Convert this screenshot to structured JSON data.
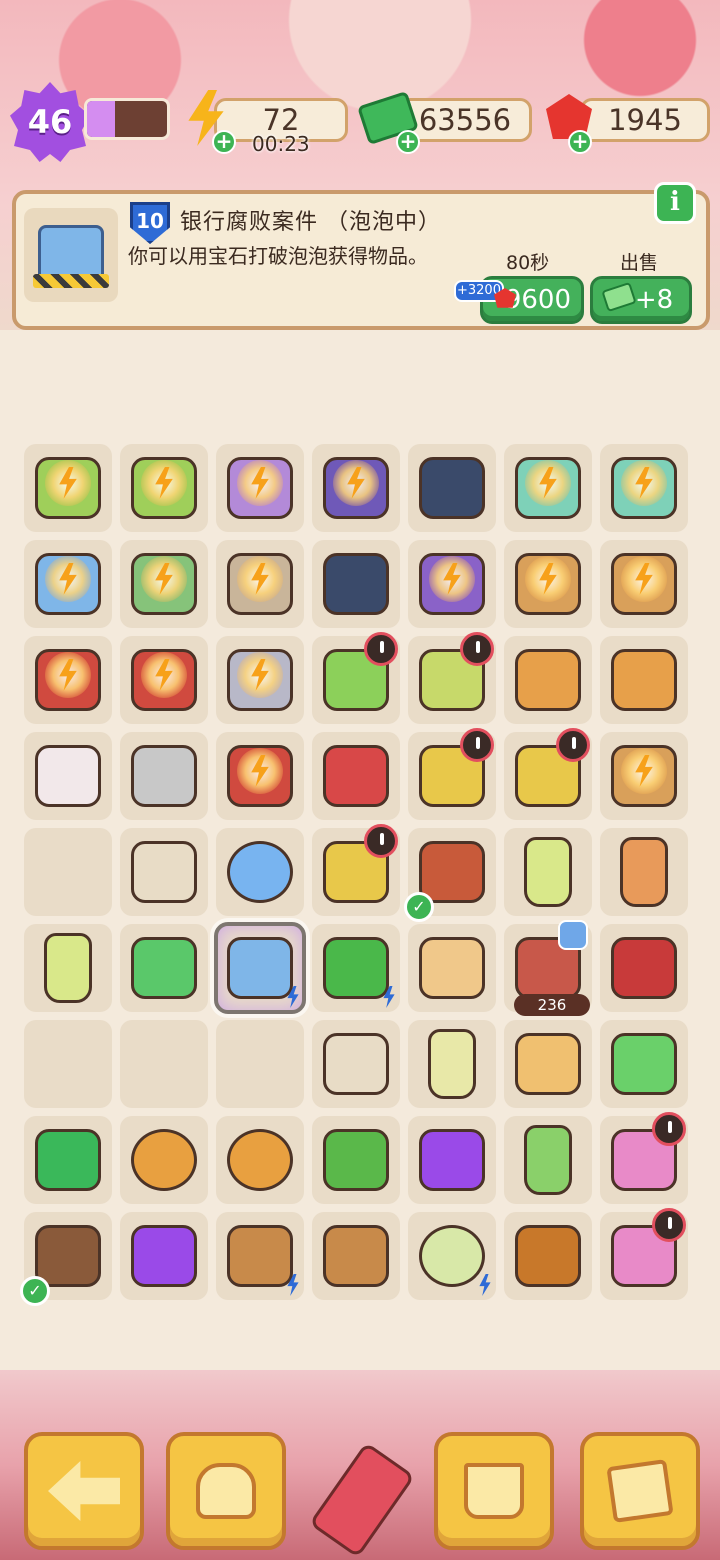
{
  "hud": {
    "level": "46",
    "xp_fraction": 0.35,
    "energy": "72",
    "energy_timer": "00:23",
    "cash": "63556",
    "gems": "1945",
    "energy_icon": "lightning-icon",
    "cash_icon": "cash-stack-icon",
    "gem_icon": "red-gem-icon"
  },
  "info": {
    "item_level": "10",
    "title": "银行腐败案件 （泡泡中）",
    "description": "你可以用宝石打破泡泡获得物品。",
    "timer_label": "80秒",
    "energy_bonus": "+3200",
    "pop_cost": "9600",
    "sell_label": "出售",
    "sell_value": "+8",
    "info_button": "i"
  },
  "grid": {
    "cells": [
      {
        "name": "bouquet-item",
        "color": "#9fcf5a",
        "bubble": true
      },
      {
        "name": "bouquet-item",
        "color": "#9fcf5a",
        "bubble": true
      },
      {
        "name": "helicopter-item",
        "color": "#b38ad8",
        "bubble": true
      },
      {
        "name": "purple-atv-item",
        "color": "#6f59b8",
        "bubble": true
      },
      {
        "name": "jeep-item",
        "color": "#3a4a6a"
      },
      {
        "name": "first-aid-item",
        "color": "#7ed1b8",
        "bubble": true
      },
      {
        "name": "first-aid-item",
        "color": "#7ed1b8",
        "bubble": true
      },
      {
        "name": "bank-building-item",
        "color": "#7fb6e8",
        "bubble": true
      },
      {
        "name": "crime-scene-item",
        "color": "#86c37a",
        "bubble": true
      },
      {
        "name": "crime-scene-item",
        "color": "#c9b59a",
        "bubble": true
      },
      {
        "name": "jeep-item",
        "color": "#3a4a6a"
      },
      {
        "name": "purple-car-item",
        "color": "#8a62c8",
        "bubble": true
      },
      {
        "name": "crate-item",
        "color": "#d9a05a",
        "bubble": true
      },
      {
        "name": "crate-item",
        "color": "#d9a05a",
        "bubble": true
      },
      {
        "name": "red-case-item",
        "color": "#d04a3f",
        "bubble": true
      },
      {
        "name": "toolbox-item",
        "color": "#d04a3f",
        "bubble": true
      },
      {
        "name": "evidence-case-item",
        "color": "#b8b8c8",
        "bubble": true
      },
      {
        "name": "washing-cart-item",
        "color": "#8cd05a",
        "clock": true
      },
      {
        "name": "washing-cart-item",
        "color": "#c7d96a",
        "clock": true
      },
      {
        "name": "dragon-vase-item",
        "color": "#e7a04a"
      },
      {
        "name": "dragon-vase-item",
        "color": "#e7a04a"
      },
      {
        "name": "glove-item",
        "color": "#f2e8ea"
      },
      {
        "name": "axe-item",
        "color": "#c8c8c8"
      },
      {
        "name": "toolbox-item",
        "color": "#d04a3f",
        "bubble": true
      },
      {
        "name": "red-toolbox-item",
        "color": "#d84848"
      },
      {
        "name": "laundry-basket-item",
        "color": "#e8c84a",
        "clock": true
      },
      {
        "name": "laundry-basket-item",
        "color": "#e8c84a",
        "clock": true
      },
      {
        "name": "crate-item",
        "color": "#d9a05a",
        "bubble": true
      },
      {
        "name": "empty-cell",
        "color": ""
      },
      {
        "name": "evidence-bag-item",
        "color": "#e8dcc6"
      },
      {
        "name": "blue-button-item",
        "color": "#78b4f0",
        "round": true
      },
      {
        "name": "yellow-bucket-item",
        "color": "#e8c84a",
        "clock": true
      },
      {
        "name": "camera-item",
        "color": "#c85a3a",
        "check": true
      },
      {
        "name": "soap-bottle-item",
        "color": "#d9e88a",
        "tall": true
      },
      {
        "name": "hourglass-item",
        "color": "#e89a5a",
        "tall": true
      },
      {
        "name": "soap-bottle-item",
        "color": "#d9e88a",
        "tall": true
      },
      {
        "name": "cash-item",
        "color": "#5ac86a"
      },
      {
        "name": "bubbled-bank-item",
        "color": "#7fb6e8",
        "selected": true,
        "zap": true
      },
      {
        "name": "green-cloth-item",
        "color": "#4ab84a",
        "zap": true
      },
      {
        "name": "sugar-cubes-item",
        "color": "#f0c88a"
      },
      {
        "name": "tv-box-item",
        "color": "#c8584a",
        "lock": true,
        "counter": "236"
      },
      {
        "name": "red-gloves-item",
        "color": "#c83a3a"
      },
      {
        "name": "empty-cell",
        "color": ""
      },
      {
        "name": "empty-cell",
        "color": ""
      },
      {
        "name": "empty-cell",
        "color": ""
      },
      {
        "name": "evidence-bag-item",
        "color": "#e8dcc6"
      },
      {
        "name": "hand-soap-item",
        "color": "#e8e8a8",
        "tall": true
      },
      {
        "name": "hourglass-card-item",
        "color": "#f0c070"
      },
      {
        "name": "brush-item",
        "color": "#6ad06a"
      },
      {
        "name": "cash-item",
        "color": "#3ab85a"
      },
      {
        "name": "magnifier-item",
        "color": "#e8a040",
        "round": true
      },
      {
        "name": "magnifier-item",
        "color": "#e8a040",
        "round": true
      },
      {
        "name": "sponge-item",
        "color": "#5ab84a"
      },
      {
        "name": "purple-gear-item",
        "color": "#9a4ae8"
      },
      {
        "name": "broom-item",
        "color": "#8ad06a",
        "tall": true
      },
      {
        "name": "flower-box-item",
        "color": "#e88ac8",
        "clock": true
      },
      {
        "name": "envelope-item",
        "color": "#8a5a3a",
        "check": true
      },
      {
        "name": "purple-star-item",
        "color": "#9a4ae8"
      },
      {
        "name": "spyglass-item",
        "color": "#c88a4a",
        "zap": true
      },
      {
        "name": "spyglass-item",
        "color": "#c88a4a"
      },
      {
        "name": "melon-item",
        "color": "#d8e8a8",
        "round": true,
        "zap": true
      },
      {
        "name": "honey-dipper-item",
        "color": "#c8782a"
      },
      {
        "name": "flower-box-item",
        "color": "#e88ac8",
        "clock": true
      }
    ]
  },
  "toolbar": {
    "back_icon": "back-arrow-icon",
    "bag_icon": "backpack-icon",
    "basket_icon": "shopping-basket-icon",
    "book_icon": "star-notebook-icon"
  }
}
